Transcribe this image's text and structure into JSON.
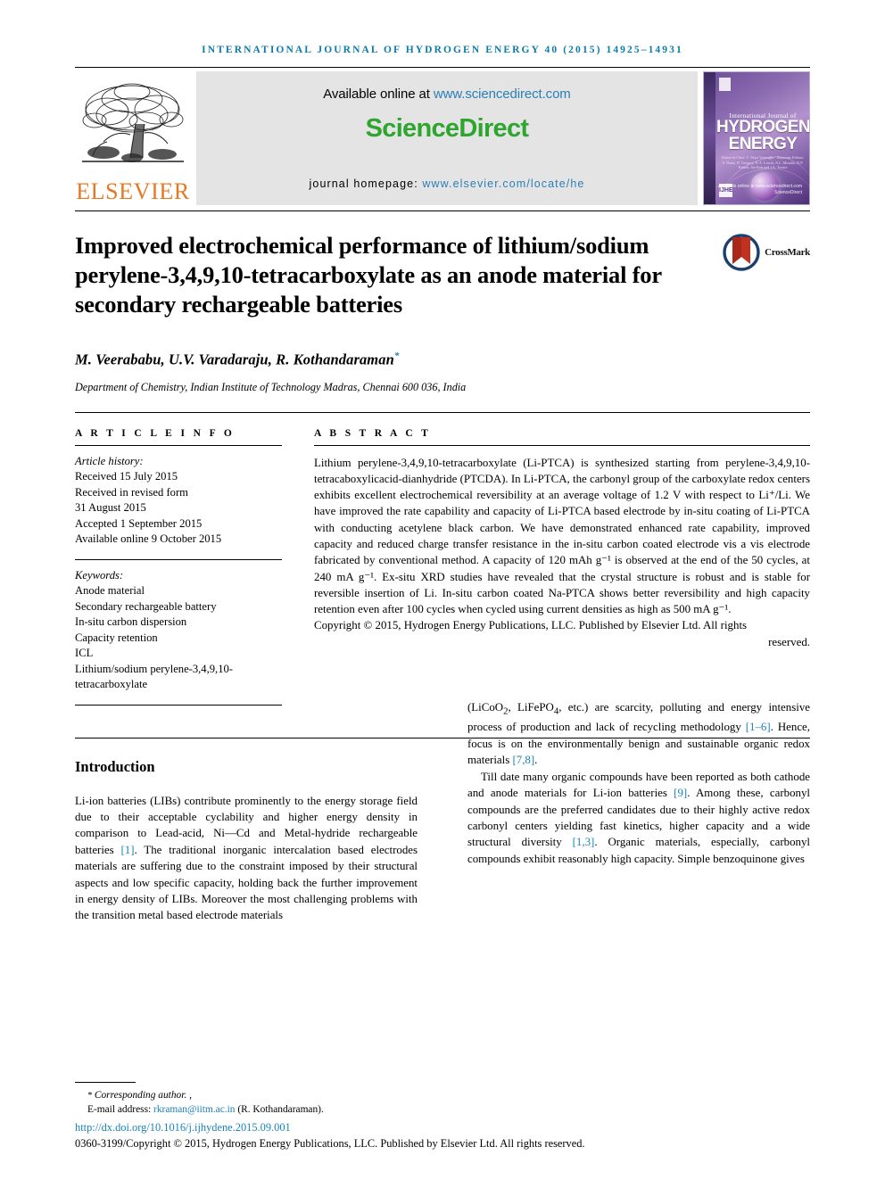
{
  "running_head": "INTERNATIONAL JOURNAL OF HYDROGEN ENERGY 40 (2015) 14925–14931",
  "masthead": {
    "publisher_wordmark": "ELSEVIER",
    "available_prefix": "Available online at ",
    "available_url": "www.sciencedirect.com",
    "sciencedirect_logo": "ScienceDirect",
    "homepage_prefix": "journal homepage: ",
    "homepage_url": "www.elsevier.com/locate/he",
    "cover": {
      "line1": "International Journal of",
      "line2": "HYDROGEN",
      "line3": "ENERGY",
      "editors": "Editor-in-Chief: T. Nejat Veziroğlu  ·  Associate Editors: S. Dunn, D. Gregory, P.-A. Lowes, A.L. Moudio, D.P. Birkett, Ian Peat and J.A. Turner",
      "imprint": "IJHE",
      "sciencedirect_footer": "Available online at www.sciencedirect.com ScienceDirect"
    }
  },
  "article": {
    "title": "Improved electrochemical performance of lithium/sodium perylene-3,4,9,10-tetracarboxylate as an anode material for secondary rechargeable batteries",
    "crossmark_label": "CrossMark",
    "authors": "M. Veerababu, U.V. Varadaraju, R. Kothandaraman",
    "corresponding_marker": "*",
    "affiliation": "Department of Chemistry, Indian Institute of Technology Madras, Chennai 600 036, India"
  },
  "article_info": {
    "heading": "A R T I C L E   I N F O",
    "history_label": "Article history:",
    "history": [
      "Received 15 July 2015",
      "Received in revised form",
      "31 August 2015",
      "Accepted 1 September 2015",
      "Available online 9 October 2015"
    ],
    "keywords_label": "Keywords:",
    "keywords": [
      "Anode material",
      "Secondary rechargeable battery",
      "In-situ carbon dispersion",
      "Capacity retention",
      "ICL",
      "Lithium/sodium perylene-3,4,9,10-",
      "tetracarboxylate"
    ]
  },
  "abstract": {
    "heading": "A B S T R A C T",
    "body": "Lithium perylene-3,4,9,10-tetracarboxylate (Li-PTCA) is synthesized starting from perylene-3,4,9,10-tetracaboxylicacid-dianhydride (PTCDA). In Li-PTCA, the carbonyl group of the carboxylate redox centers exhibits excellent electrochemical reversibility at an average voltage of 1.2 V with respect to Li⁺/Li. We have improved the rate capability and capacity of Li-PTCA based electrode by in-situ coating of Li-PTCA with conducting acetylene black carbon. We have demonstrated enhanced rate capability, improved capacity and reduced charge transfer resistance in the in-situ carbon coated electrode vis a vis electrode fabricated by conventional method. A capacity of 120 mAh g⁻¹ is observed at the end of the 50 cycles, at 240 mA g⁻¹. Ex-situ XRD studies have revealed that the crystal structure is robust and is stable for reversible insertion of Li. In-situ carbon coated Na-PTCA shows better reversibility and high capacity retention even after 100 cycles when cycled using current densities as high as 500 mA g⁻¹.",
    "copyright_main": "Copyright © 2015, Hydrogen Energy Publications, LLC. Published by Elsevier Ltd. All rights",
    "copyright_tail": "reserved."
  },
  "body": {
    "section_heading": "Introduction",
    "left_para_1_a": "Li-ion batteries (LIBs) contribute prominently to the energy storage field due to their acceptable cyclability and higher energy density in comparison to Lead-acid, Ni—Cd and Metal-hydride rechargeable batteries ",
    "left_ref_1": "[1]",
    "left_para_1_b": ". The traditional inorganic intercalation based electrodes materials are suffering due to the constraint imposed by their structural aspects and low specific capacity, holding back the further improvement in energy density of LIBs. Moreover the most challenging problems with the transition metal based electrode materials",
    "right_para_1_a": "(LiCoO",
    "right_para_1_sub1": "2",
    "right_para_1_b": ", LiFePO",
    "right_para_1_sub2": "4",
    "right_para_1_c": ", etc.) are scarcity, polluting and energy intensive process of production and lack of recycling methodology ",
    "right_ref_1": "[1–6]",
    "right_para_1_d": ". Hence, focus is on the environmentally benign and sustainable organic redox materials ",
    "right_ref_2": "[7,8]",
    "right_para_1_e": ".",
    "right_para_2_a": "Till date many organic compounds have been reported as both cathode and anode materials for Li-ion batteries ",
    "right_ref_3": "[9]",
    "right_para_2_b": ". Among these, carbonyl compounds are the preferred candidates due to their highly active redox carbonyl centers yielding fast kinetics, higher capacity and a wide structural diversity ",
    "right_ref_4": "[1,3]",
    "right_para_2_c": ". Organic materials, especially, carbonyl compounds exhibit reasonably high capacity. Simple benzoquinone gives"
  },
  "footnote": {
    "star": "*",
    "corresponding": "Corresponding author. ,",
    "email_label": "E-mail address: ",
    "email": "rkraman@iitm.ac.in",
    "email_owner": " (R. Kothandaraman).",
    "doi": "http://dx.doi.org/10.1016/j.ijhydene.2015.09.001",
    "issn_line": "0360-3199/Copyright © 2015, Hydrogen Energy Publications, LLC. Published by Elsevier Ltd. All rights reserved."
  },
  "colors": {
    "link": "#1a82b8",
    "running_head": "#0b7ca8",
    "elsevier_orange": "#E87722",
    "sciencedirect_green": "#2ea52e"
  }
}
